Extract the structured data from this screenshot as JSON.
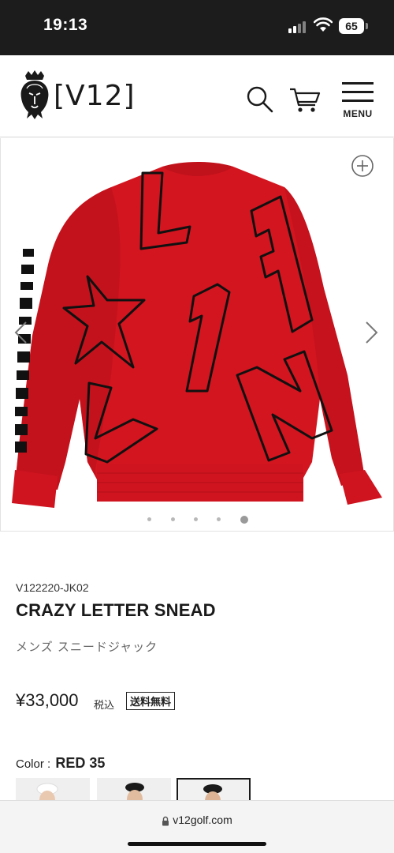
{
  "status_bar": {
    "time": "19:13",
    "battery": "65"
  },
  "header": {
    "logo_text": "[V12]",
    "menu_label": "MENU"
  },
  "gallery": {
    "slide_count": 5,
    "active_slide": 5
  },
  "product": {
    "sku": "V122220-JK02",
    "title": "CRAZY LETTER SNEAD",
    "subtitle": "メンズ スニードジャック",
    "price": "¥33,000",
    "tax_note": "税込",
    "shipping_badge": "送料無料"
  },
  "color": {
    "label": "Color :",
    "value": "RED 35"
  },
  "browser": {
    "url": "v12golf.com"
  },
  "colors": {
    "jacket_red": "#d3151f",
    "status_bar_bg": "#1c1c1c"
  }
}
